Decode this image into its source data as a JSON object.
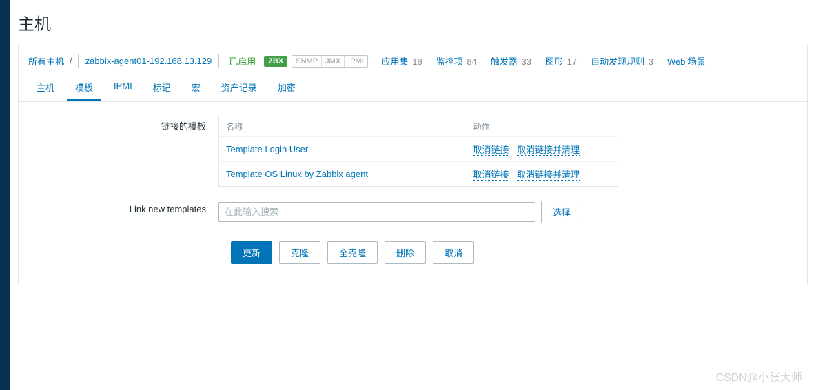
{
  "page": {
    "title": "主机"
  },
  "breadcrumb": {
    "all_hosts": "所有主机",
    "separator": "/",
    "host_name": "zabbix-agent01-192.168.13.129",
    "status": "已启用",
    "zbx_badge": "ZBX",
    "snmp": "SNMP",
    "jmx": "JMX",
    "ipmi": "IPMI"
  },
  "stats": {
    "apps": {
      "label": "应用集",
      "count": "18"
    },
    "items": {
      "label": "监控项",
      "count": "84"
    },
    "triggers": {
      "label": "触发器",
      "count": "33"
    },
    "graphs": {
      "label": "图形",
      "count": "17"
    },
    "discovery": {
      "label": "自动发现规则",
      "count": "3"
    },
    "web": {
      "label": "Web 场景",
      "count": ""
    }
  },
  "tabs": {
    "host": "主机",
    "templates": "模板",
    "ipmi": "IPMI",
    "tags": "标记",
    "macros": "宏",
    "inventory": "资产记录",
    "encryption": "加密"
  },
  "form": {
    "linked_templates_label": "链接的模板",
    "link_new_templates_label": "Link new templates",
    "table_headers": {
      "name": "名称",
      "action": "动作"
    },
    "templates": [
      {
        "name": "Template Login User"
      },
      {
        "name": "Template OS Linux by Zabbix agent"
      }
    ],
    "action_unlink": "取消链接",
    "action_unlink_clear": "取消链接并清理",
    "search_placeholder": "在此输入搜索",
    "select_btn": "选择"
  },
  "buttons": {
    "update": "更新",
    "clone": "克隆",
    "full_clone": "全克隆",
    "delete": "删除",
    "cancel": "取消"
  },
  "watermark": "CSDN@小张大师"
}
